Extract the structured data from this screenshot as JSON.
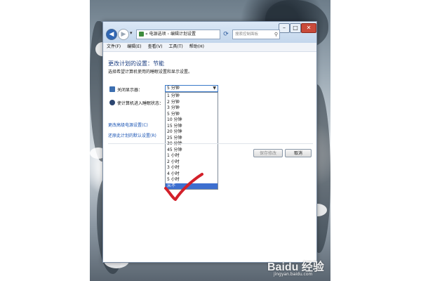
{
  "address_bar": {
    "breadcrumb_sep": "«",
    "items": [
      "电源选项",
      "编辑计划设置"
    ],
    "arrow_sep": "›"
  },
  "search": {
    "placeholder": "搜索控制面板"
  },
  "menu": [
    "文件(F)",
    "编辑(E)",
    "查看(V)",
    "工具(T)",
    "帮助(H)"
  ],
  "content": {
    "heading": "更改计划的设置：节能",
    "subtext": "选择希望计算机使用的睡眠设置和显示设置。",
    "display_label": "关闭显示器：",
    "sleep_label": "使计算机进入睡眠状态：",
    "display_value": "5 分钟",
    "options": [
      "1 分钟",
      "2 分钟",
      "3 分钟",
      "5 分钟",
      "10 分钟",
      "15 分钟",
      "20 分钟",
      "25 分钟",
      "30 分钟",
      "45 分钟",
      "1 小时",
      "2 小时",
      "3 小时",
      "4 小时",
      "5 小时",
      "从不"
    ],
    "selected_option": "从不",
    "advanced_link": "更改高级电源设置(C)",
    "restore_link": "还原此计划的默认设置(R)",
    "save_button": "保存修改",
    "cancel_button": "取消"
  },
  "watermark": {
    "brand": "Baidu 经验",
    "url": "jingyan.baidu.com"
  },
  "colors": {
    "link": "#1e57b5",
    "selection": "#3d6fd0",
    "checkmark": "#d3202a"
  }
}
